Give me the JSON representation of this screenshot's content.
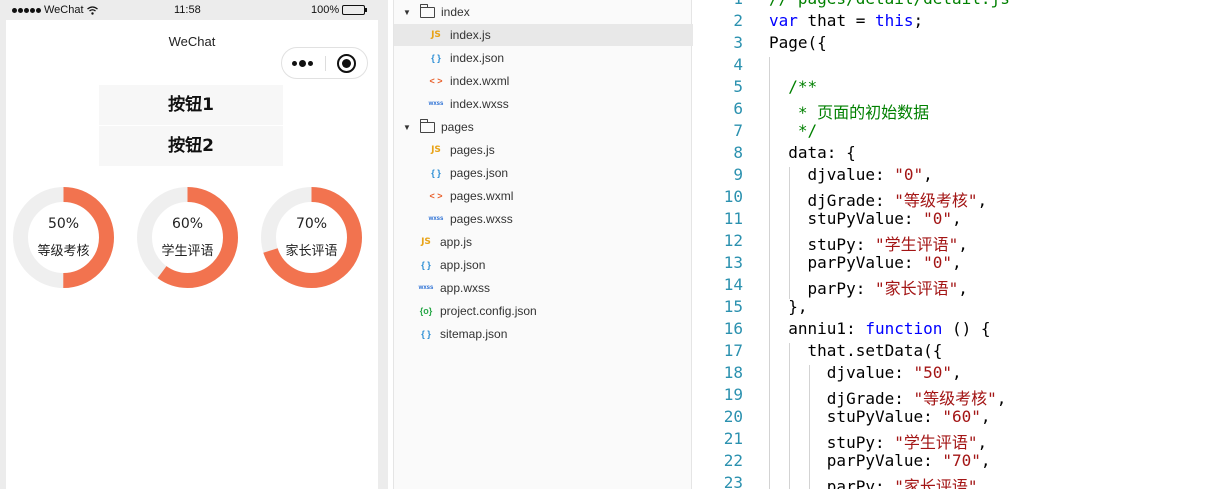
{
  "simulator": {
    "status_bar": {
      "carrier": "WeChat",
      "time": "11:58",
      "battery": "100%"
    },
    "nav_title": "WeChat",
    "buttons": [
      "按钮1",
      "按钮2"
    ],
    "rings": [
      {
        "percent": "50%",
        "label": "等级考核",
        "value": 50
      },
      {
        "percent": "60%",
        "label": "学生评语",
        "value": 60
      },
      {
        "percent": "70%",
        "label": "家长评语",
        "value": 70
      }
    ],
    "colors": {
      "ring_fill": "#f2734f",
      "ring_track": "#efefef"
    }
  },
  "explorer": {
    "items": [
      {
        "label": "index",
        "type": "folder",
        "expanded": true,
        "depth": 0
      },
      {
        "label": "index.js",
        "type": "js",
        "depth": 1,
        "selected": true
      },
      {
        "label": "index.json",
        "type": "json",
        "depth": 1
      },
      {
        "label": "index.wxml",
        "type": "wxml",
        "depth": 1
      },
      {
        "label": "index.wxss",
        "type": "wxss",
        "depth": 1
      },
      {
        "label": "pages",
        "type": "folder",
        "expanded": true,
        "depth": 0
      },
      {
        "label": "pages.js",
        "type": "js",
        "depth": 1
      },
      {
        "label": "pages.json",
        "type": "json",
        "depth": 1
      },
      {
        "label": "pages.wxml",
        "type": "wxml",
        "depth": 1
      },
      {
        "label": "pages.wxss",
        "type": "wxss",
        "depth": 1
      },
      {
        "label": "app.js",
        "type": "js",
        "depth": 0
      },
      {
        "label": "app.json",
        "type": "json",
        "depth": 0
      },
      {
        "label": "app.wxss",
        "type": "wxss",
        "depth": 0
      },
      {
        "label": "project.config.json",
        "type": "config",
        "depth": 0
      },
      {
        "label": "sitemap.json",
        "type": "json",
        "depth": 0
      }
    ],
    "icon_glyphs": {
      "js": "JS",
      "json": "{ }",
      "wxml": "< >",
      "wxss": "wxss",
      "config": "{o}"
    }
  },
  "editor": {
    "lines": [
      {
        "n": "1",
        "tokens": [
          [
            "cm",
            "// pages/detail/detail.js"
          ]
        ]
      },
      {
        "n": "2",
        "tokens": [
          [
            "kw",
            "var"
          ],
          [
            "",
            " that = "
          ],
          [
            "kw",
            "this"
          ],
          [
            "",
            ";"
          ]
        ]
      },
      {
        "n": "3",
        "tokens": [
          [
            "",
            "Page({"
          ]
        ]
      },
      {
        "n": "4",
        "tokens": []
      },
      {
        "n": "5",
        "tokens": [
          [
            "",
            "  "
          ],
          [
            "cm",
            "/**"
          ]
        ]
      },
      {
        "n": "6",
        "tokens": [
          [
            "",
            "  "
          ],
          [
            "cm",
            " * 页面的初始数据"
          ]
        ]
      },
      {
        "n": "7",
        "tokens": [
          [
            "",
            "  "
          ],
          [
            "cm",
            " */"
          ]
        ]
      },
      {
        "n": "8",
        "tokens": [
          [
            "",
            "  data: {"
          ]
        ]
      },
      {
        "n": "9",
        "tokens": [
          [
            "",
            "    djvalue: "
          ],
          [
            "str",
            "\"0\""
          ],
          [
            "",
            ","
          ]
        ]
      },
      {
        "n": "10",
        "tokens": [
          [
            "",
            "    djGrade: "
          ],
          [
            "str",
            "\"等级考核\""
          ],
          [
            "",
            ","
          ]
        ]
      },
      {
        "n": "11",
        "tokens": [
          [
            "",
            "    stuPyValue: "
          ],
          [
            "str",
            "\"0\""
          ],
          [
            "",
            ","
          ]
        ]
      },
      {
        "n": "12",
        "tokens": [
          [
            "",
            "    stuPy: "
          ],
          [
            "str",
            "\"学生评语\""
          ],
          [
            "",
            ","
          ]
        ]
      },
      {
        "n": "13",
        "tokens": [
          [
            "",
            "    parPyValue: "
          ],
          [
            "str",
            "\"0\""
          ],
          [
            "",
            ","
          ]
        ]
      },
      {
        "n": "14",
        "tokens": [
          [
            "",
            "    parPy: "
          ],
          [
            "str",
            "\"家长评语\""
          ],
          [
            "",
            ","
          ]
        ]
      },
      {
        "n": "15",
        "tokens": [
          [
            "",
            "  },"
          ]
        ]
      },
      {
        "n": "16",
        "tokens": [
          [
            "",
            "  anniu1: "
          ],
          [
            "kw",
            "function"
          ],
          [
            "",
            " () {"
          ]
        ]
      },
      {
        "n": "17",
        "tokens": [
          [
            "",
            "    that.setData({"
          ]
        ]
      },
      {
        "n": "18",
        "tokens": [
          [
            "",
            "      djvalue: "
          ],
          [
            "str",
            "\"50\""
          ],
          [
            "",
            ","
          ]
        ]
      },
      {
        "n": "19",
        "tokens": [
          [
            "",
            "      djGrade: "
          ],
          [
            "str",
            "\"等级考核\""
          ],
          [
            "",
            ","
          ]
        ]
      },
      {
        "n": "20",
        "tokens": [
          [
            "",
            "      stuPyValue: "
          ],
          [
            "str",
            "\"60\""
          ],
          [
            "",
            ","
          ]
        ]
      },
      {
        "n": "21",
        "tokens": [
          [
            "",
            "      stuPy: "
          ],
          [
            "str",
            "\"学生评语\""
          ],
          [
            "",
            ","
          ]
        ]
      },
      {
        "n": "22",
        "tokens": [
          [
            "",
            "      parPyValue: "
          ],
          [
            "str",
            "\"70\""
          ],
          [
            "",
            ","
          ]
        ]
      },
      {
        "n": "23",
        "tokens": [
          [
            "",
            "      parPy: "
          ],
          [
            "str",
            "\"家长评语\""
          ],
          [
            "",
            ","
          ]
        ]
      }
    ]
  }
}
